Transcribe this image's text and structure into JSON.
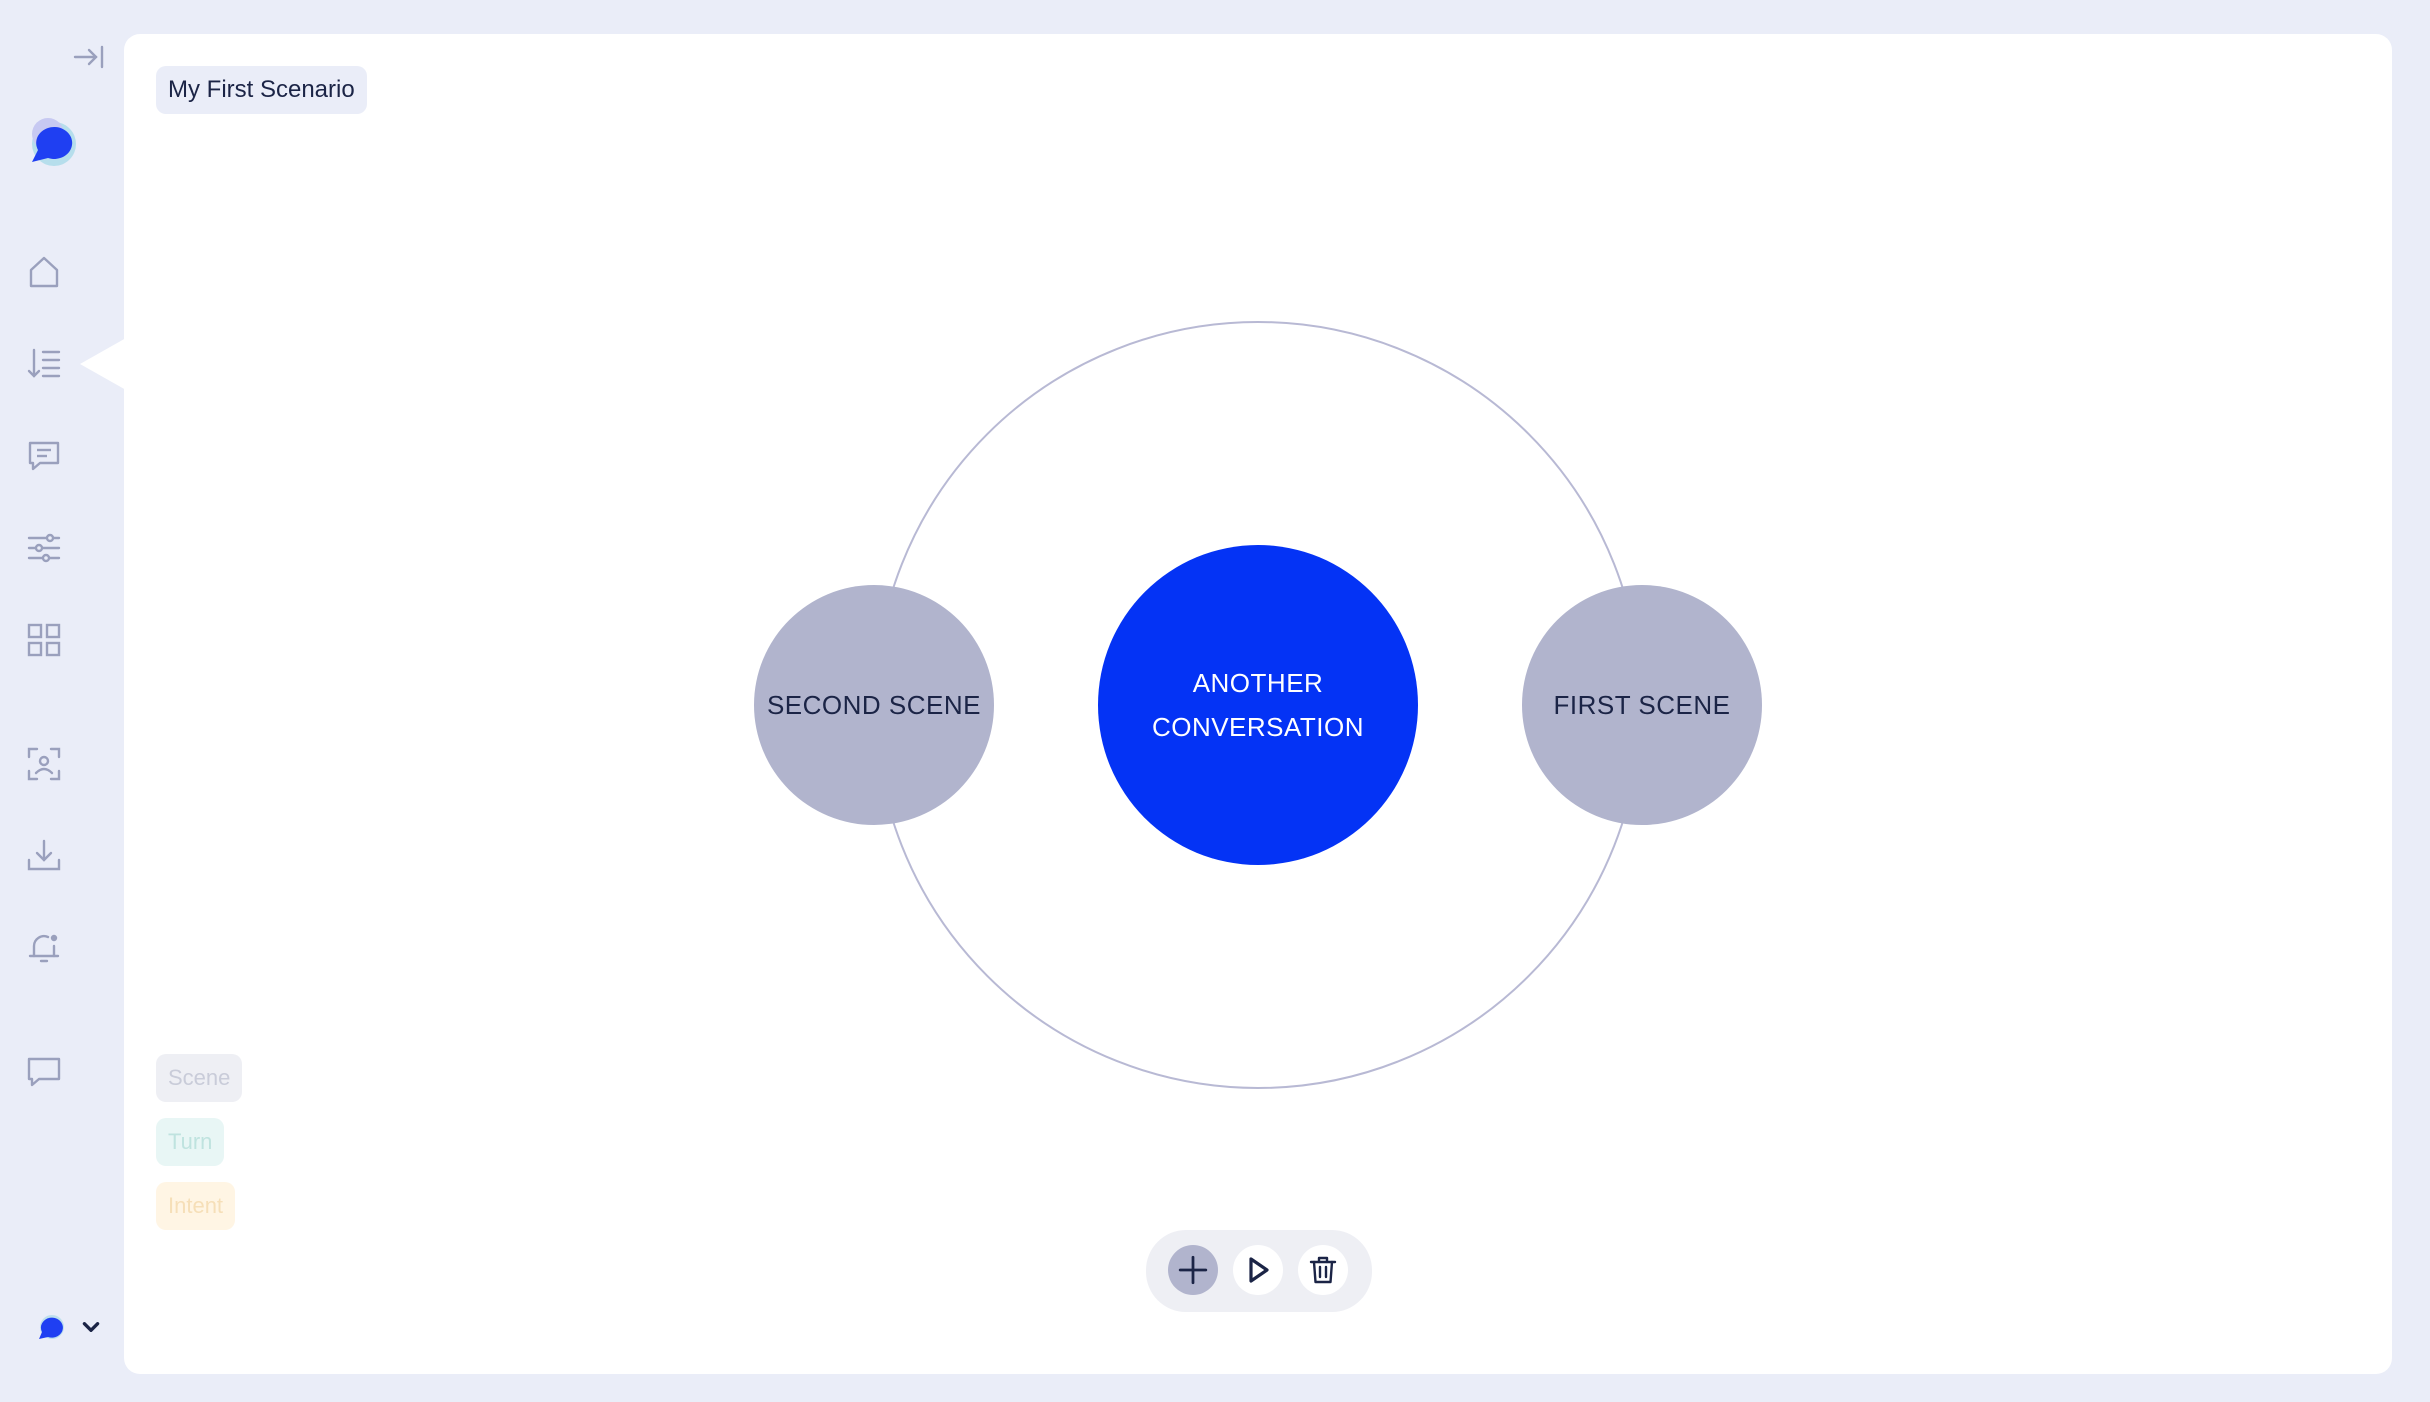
{
  "scenario": {
    "title": "My First Scenario"
  },
  "graph": {
    "center": {
      "label_line1": "ANOTHER",
      "label_line2": "CONVERSATION",
      "color": "#0433f5"
    },
    "left_node": {
      "label": "SECOND SCENE",
      "color": "#b1b4cd"
    },
    "right_node": {
      "label": "FIRST SCENE",
      "color": "#b1b4cd"
    },
    "ring_color": "#b8b9d4",
    "label_dark_color": "#1b2446"
  },
  "legend": [
    {
      "label": "Scene",
      "bg": "#eeeff4",
      "fg": "#c9ccd9"
    },
    {
      "label": "Turn",
      "bg": "#e8f6f5",
      "fg": "#bfe3df"
    },
    {
      "label": "Intent",
      "bg": "#fff5e4",
      "fg": "#f6dfb8"
    }
  ],
  "sidebar": {
    "items": [
      {
        "name": "home-icon"
      },
      {
        "name": "scenarios-icon"
      },
      {
        "name": "messages-icon"
      },
      {
        "name": "settings-sliders-icon"
      },
      {
        "name": "grid-icon"
      },
      {
        "name": "face-scan-icon"
      },
      {
        "name": "download-icon"
      },
      {
        "name": "notification-icon"
      },
      {
        "name": "chat-icon"
      }
    ],
    "icon_color": "#9aa0bd",
    "brand_color": "#1f3ff2"
  },
  "toolbar": {
    "buttons": [
      {
        "name": "add-button",
        "icon": "plus-icon"
      },
      {
        "name": "play-button",
        "icon": "play-icon"
      },
      {
        "name": "delete-button",
        "icon": "trash-icon"
      }
    ]
  }
}
